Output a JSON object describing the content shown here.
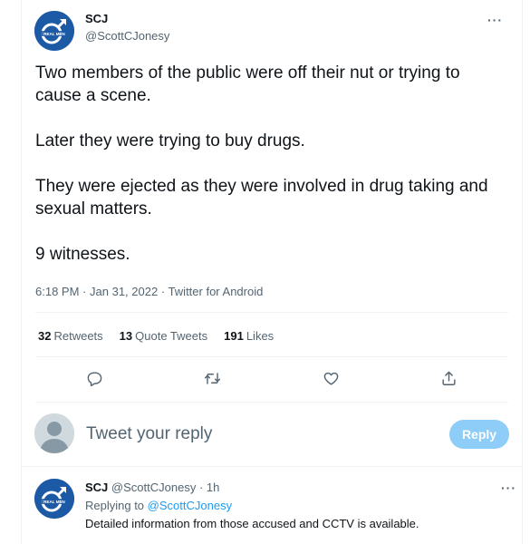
{
  "tweet": {
    "author_name": "SCJ",
    "author_handle": "@ScottCJonesy",
    "more_label": "···",
    "paragraphs": [
      "Two members of the public were off their nut or trying to cause a scene.",
      "Later they were trying to buy drugs.",
      "They were ejected as they were involved in drug taking and sexual matters.",
      "9 witnesses."
    ],
    "time": "6:18 PM",
    "date": "Jan 31, 2022",
    "source": "Twitter for Android",
    "sep": "·"
  },
  "stats": {
    "retweets_count": "32",
    "retweets_label": "Retweets",
    "quotes_count": "13",
    "quotes_label": "Quote Tweets",
    "likes_count": "191",
    "likes_label": "Likes"
  },
  "actions": [
    "reply-icon",
    "retweet-icon",
    "like-icon",
    "share-icon"
  ],
  "reply_box": {
    "placeholder": "Tweet your reply",
    "button_label": "Reply"
  },
  "reply_tweet": {
    "author_name": "SCJ",
    "author_handle": "@ScottCJonesy",
    "age": "1h",
    "sep": "·",
    "replying_prefix": "Replying to",
    "replying_handle": "@ScottCJonesy",
    "text": "Detailed information from those accused and CCTV is available.",
    "more_label": "···"
  },
  "colors": {
    "accent": "#1d9bf0",
    "reply_button": "#8ecdf8",
    "avatar_brand": "#1c5aa6"
  }
}
